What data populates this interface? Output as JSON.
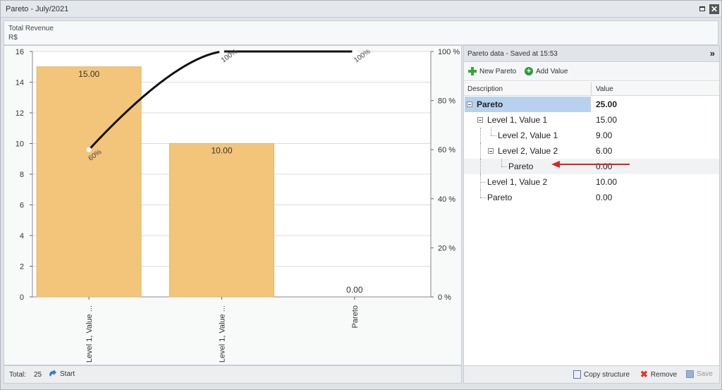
{
  "window": {
    "title": "Pareto - July/2021"
  },
  "header": {
    "metric_name": "Total Revenue",
    "unit": "R$"
  },
  "chart_data": {
    "type": "bar",
    "categories": [
      "Level 1, Value ...",
      "Level 1, Value ...",
      "Pareto"
    ],
    "values": [
      15,
      10,
      0
    ],
    "value_labels": [
      "15.00",
      "10.00",
      "0.00"
    ],
    "ylim": [
      0,
      16
    ],
    "y_ticks": [
      0,
      2,
      4,
      6,
      8,
      10,
      12,
      14,
      16
    ],
    "cumulative_percent": [
      60,
      100,
      100
    ],
    "cumulative_labels": [
      "60%",
      "100%",
      "100%"
    ],
    "y2lim": [
      0,
      100
    ],
    "y2_ticks": [
      "0 %",
      "20 %",
      "40 %",
      "60 %",
      "80 %",
      "100 %"
    ],
    "bar_color": "#f2c57a",
    "line_color": "#111111",
    "grid": true
  },
  "chart_footer": {
    "total_label": "Total:",
    "total_value": "25",
    "start_label": "Start"
  },
  "side_panel": {
    "title": "Pareto data - Saved at 15:53",
    "collapse_icon": "double-chevron-right",
    "toolbar": {
      "new_label": "New Pareto",
      "add_label": "Add Value"
    },
    "columns": {
      "description": "Description",
      "value": "Value"
    },
    "rows": [
      {
        "label": "Pareto",
        "value": "25.00"
      },
      {
        "label": "Level 1, Value 1",
        "value": "15.00"
      },
      {
        "label": "Level 2, Value 1",
        "value": "9.00"
      },
      {
        "label": "Level 2, Value 2",
        "value": "6.00"
      },
      {
        "label": "Pareto",
        "value": "0.00"
      },
      {
        "label": "Level 1, Value 2",
        "value": "10.00"
      },
      {
        "label": "Pareto",
        "value": "0.00"
      }
    ],
    "footer": {
      "copy_label": "Copy structure",
      "remove_label": "Remove",
      "save_label": "Save"
    }
  },
  "annotation": {
    "arrow_color": "#e02020"
  }
}
